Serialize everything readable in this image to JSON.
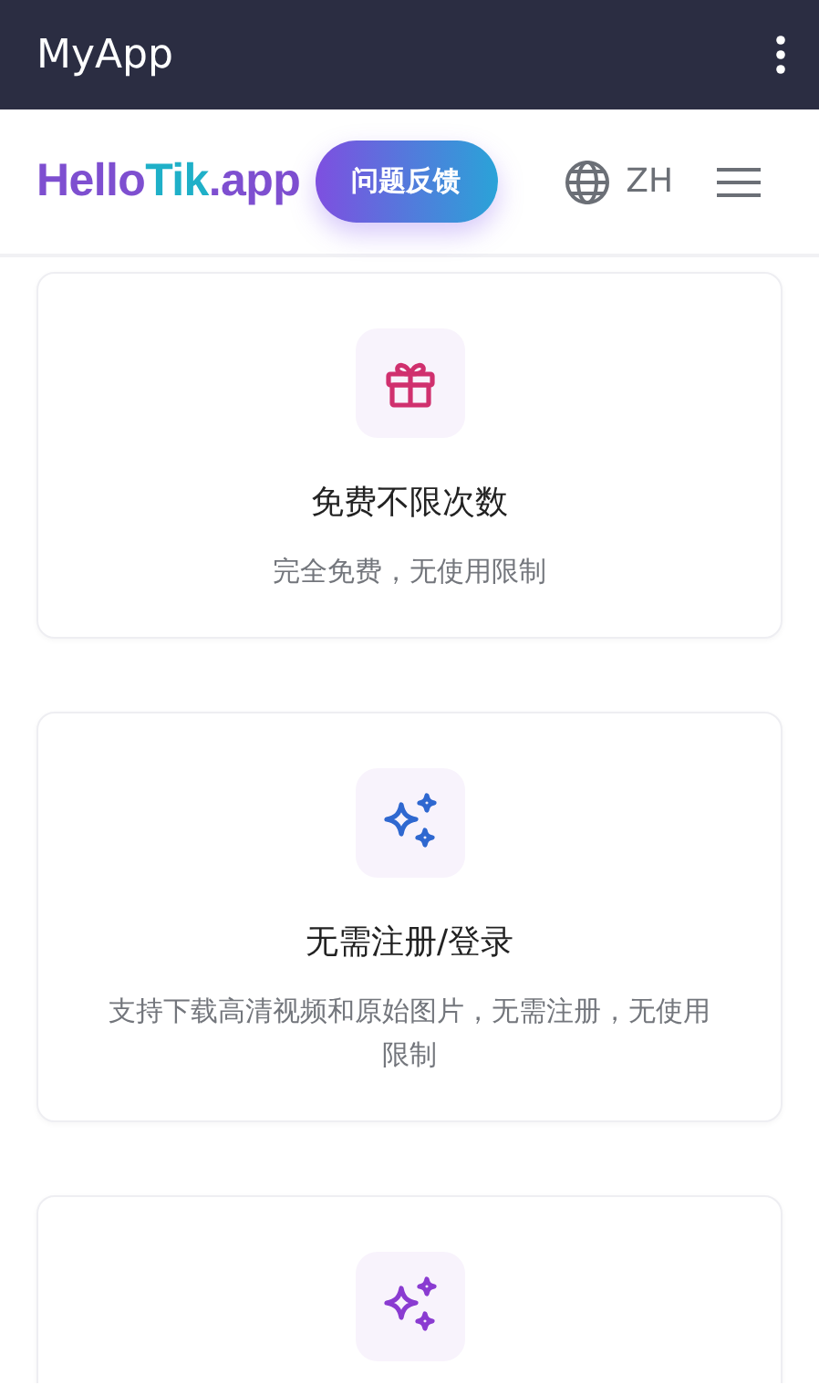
{
  "app_bar": {
    "title": "MyApp"
  },
  "header": {
    "logo_parts": [
      {
        "text": "Hello",
        "color": "#7e4fd0"
      },
      {
        "text": "Tik",
        "color": "#1fb0c8"
      },
      {
        "text": ".app",
        "color": "#7e4fd0"
      }
    ],
    "feedback_button": "问题反馈",
    "language": "ZH"
  },
  "features": [
    {
      "kind": "gift",
      "color": "#d0306e",
      "title": "免费不限次数",
      "description": "完全免费，无使用限制"
    },
    {
      "kind": "sparkles",
      "color": "#2f68d0",
      "title": "无需注册/登录",
      "description": "支持下载高清视频和原始图片，无需注册，无使用限制"
    },
    {
      "kind": "sparkles",
      "color": "#8a3bd1"
    }
  ]
}
